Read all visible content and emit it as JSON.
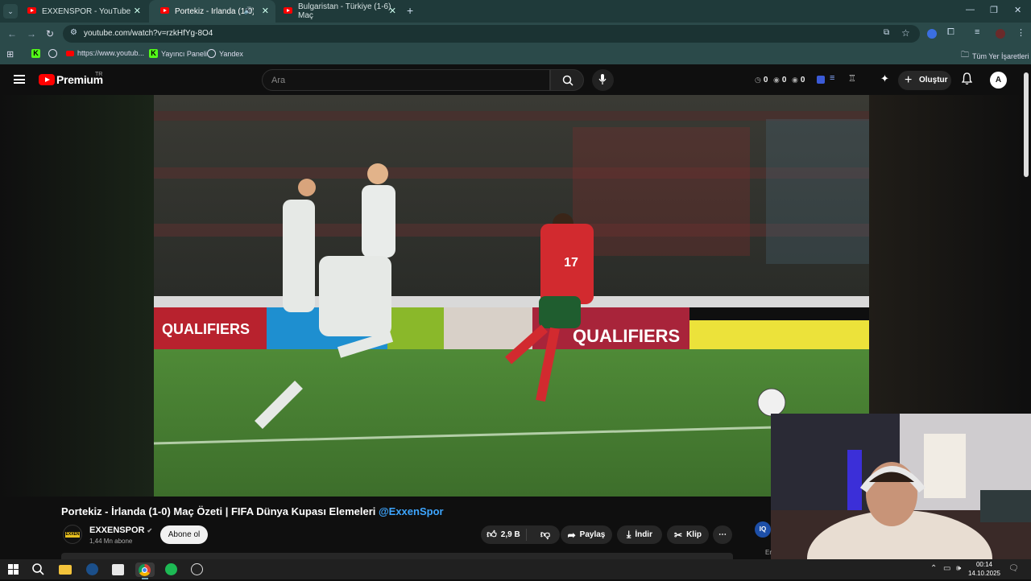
{
  "browser": {
    "tabs": [
      {
        "title": "EXXENSPOR - YouTube",
        "active": false
      },
      {
        "title": "Portekiz - İrlanda (1-0) Maç",
        "active": true,
        "audio": true
      },
      {
        "title": "Bulgaristan - Türkiye (1-6) Maç",
        "active": false
      }
    ],
    "url": "youtube.com/watch?v=rzkHfYg-8O4",
    "bookmarks": [
      {
        "label": "",
        "icon": "kick-icon"
      },
      {
        "label": "",
        "icon": "globe-icon"
      },
      {
        "label": "https://www.youtub...",
        "icon": "youtube-icon"
      },
      {
        "label": "Yayıncı Paneli",
        "icon": "kick-icon"
      },
      {
        "label": "Yandex",
        "icon": "globe-icon"
      }
    ],
    "all_bookmarks_label": "Tüm Yer İşaretleri"
  },
  "youtube": {
    "logo_text": "Premium",
    "region": "TR",
    "search_placeholder": "Ara",
    "stats": [
      "0",
      "0",
      "0"
    ],
    "create_label": "Oluştur",
    "avatar_initials": "A"
  },
  "video": {
    "title_main": "Portekiz - İrlanda (1-0) Maç Özeti | FIFA Dünya Kupası Elemeleri ",
    "title_tag": "@ExxenSpor",
    "jersey_number": "17",
    "board_text": "QUALIFIERS"
  },
  "channel": {
    "name": "EXXENSPOR",
    "subscribers": "1,44 Mn abone",
    "subscribe_label": "Abone ol"
  },
  "actions": {
    "likes": "2,9 B",
    "share": "Paylaş",
    "download": "İndir",
    "clip": "Klip",
    "iq_badge": "IQ",
    "truncated": "Er"
  },
  "taskbar": {
    "time": "00:14",
    "date": "14.10.2025"
  },
  "colors": {
    "accent_link": "#3ea6ff",
    "youtube_red": "#ff0000",
    "chrome_frame": "#1f3a3a"
  }
}
